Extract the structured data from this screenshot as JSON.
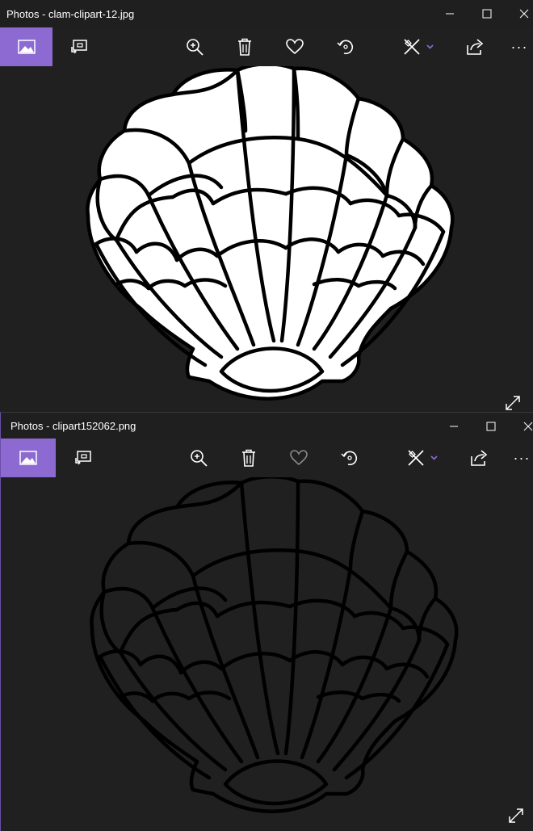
{
  "windows": [
    {
      "title": "Photos - clam-clipart-12.jpg",
      "image": {
        "style": "white shell with black outline"
      }
    },
    {
      "title": "Photos - clipart152062.png",
      "image": {
        "style": "black outline on transparent (dark) background"
      }
    }
  ],
  "toolbar": {
    "icons": [
      "photo-view-icon",
      "slideshow-icon",
      "zoom-in-icon",
      "delete-icon",
      "favorite-heart-icon",
      "rotate-icon",
      "edit-create-icon",
      "share-icon",
      "more-icon"
    ],
    "more_label": "···"
  },
  "colors": {
    "accent": "#8d6ad2",
    "background": "#202020",
    "titlebar": "#1f1f1f",
    "icon": "#ffffff",
    "heart_disabled": "#8a8a8a"
  }
}
